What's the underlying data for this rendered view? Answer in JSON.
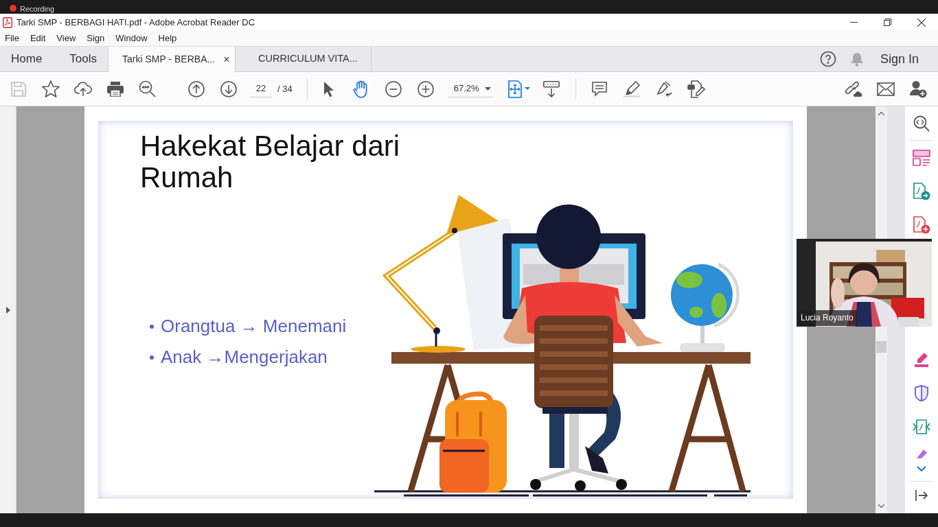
{
  "recording": {
    "label": "Recording"
  },
  "window": {
    "title": "Tarki SMP - BERBAGI HATI.pdf - Adobe Acrobat Reader DC"
  },
  "menu": [
    "File",
    "Edit",
    "View",
    "Sign",
    "Window",
    "Help"
  ],
  "nav": [
    "Home",
    "Tools"
  ],
  "tabs": [
    {
      "label": "Tarki SMP - BERBA...",
      "selected": true,
      "close": "×"
    },
    {
      "label": "CURRICULUM VITA...",
      "selected": false
    }
  ],
  "account": {
    "sign_in": "Sign In"
  },
  "toolbar": {
    "page": "22",
    "page_total": "/ 34",
    "zoom": "67.2%"
  },
  "slide": {
    "title": "Hakekat Belajar dari Rumah",
    "bullets": [
      "Orangtua → Menemani",
      "Anak →Mengerjakan"
    ]
  },
  "video": {
    "name": "Lucia Royanto"
  }
}
